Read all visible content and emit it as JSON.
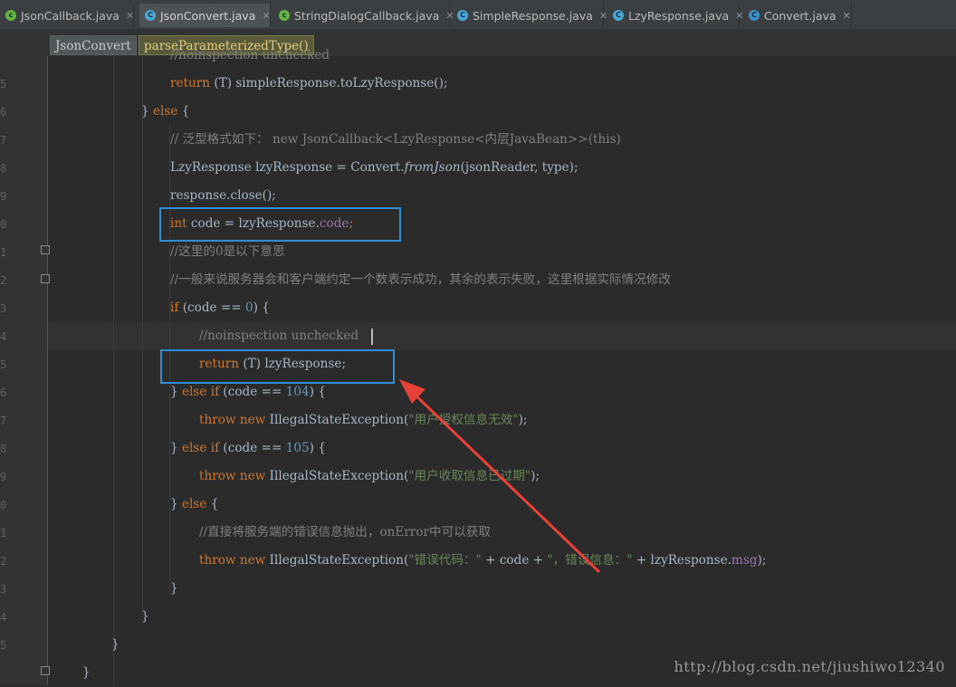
{
  "tabs": [
    {
      "label": "JsonCallback.java",
      "icon": "java-class-icon",
      "active": false
    },
    {
      "label": "JsonConvert.java",
      "icon": "java-class-icon",
      "active": true
    },
    {
      "label": "StringDialogCallback.java",
      "icon": "java-class-icon",
      "active": false
    },
    {
      "label": "SimpleResponse.java",
      "icon": "java-class-icon",
      "active": false
    },
    {
      "label": "LzyResponse.java",
      "icon": "java-class-icon",
      "active": false
    },
    {
      "label": "Convert.java",
      "icon": "java-class-icon",
      "active": false
    }
  ],
  "tab_close_glyph": "✕",
  "breadcrumbs": {
    "class_name": "JsonConvert",
    "method_name": "parseParameterizedType()"
  },
  "gutter": {
    "line_digits": [
      "5",
      "6",
      "7",
      "8",
      "9",
      "0",
      "1",
      "2",
      "3",
      "4",
      "5",
      "6",
      "7",
      "8",
      "9",
      "0",
      "1",
      "2",
      "3",
      "4",
      "5"
    ]
  },
  "code": {
    "l0": "//noinspection unchecked",
    "l1_return": "return",
    "l1_rest": " (T) simpleResponse.toLzyResponse();",
    "l2_brace": "} ",
    "l2_else": "else",
    "l2_open": " {",
    "l3": "// 泛型格式如下： new JsonCallback<LzyResponse<内层JavaBean>>(this)",
    "l4_a": "LzyResponse lzyResponse = Convert.",
    "l4_b": "fromJson",
    "l4_c": "(jsonReader, type);",
    "l5": "response.close();",
    "l6_int": "int",
    "l6_mid": " code = lzyResponse.",
    "l6_field": "code",
    "l6_end": ";",
    "l7": "//这里的0是以下意思",
    "l8": "//一般来说服务器会和客户端约定一个数表示成功，其余的表示失败，这里根据实际情况修改",
    "l9_if": "if",
    "l9_a": " (code == ",
    "l9_num": "0",
    "l9_b": ") {",
    "l10": "//noinspection unchecked",
    "l11_return": "return",
    "l11_rest": " (T) lzyResponse;",
    "l12_a": "} ",
    "l12_kw": "else if",
    "l12_b": " (code == ",
    "l12_num": "104",
    "l12_c": ") {",
    "l13_throw": "throw",
    "l13_new": " new",
    "l13_a": " IllegalStateException(",
    "l13_str": "\"用户授权信息无效\"",
    "l13_end": ");",
    "l14_a": "} ",
    "l14_kw": "else if",
    "l14_b": " (code == ",
    "l14_num": "105",
    "l14_c": ") {",
    "l15_throw": "throw",
    "l15_new": " new",
    "l15_a": " IllegalStateException(",
    "l15_str": "\"用户收取信息已过期\"",
    "l15_end": ");",
    "l16_a": "} ",
    "l16_kw": "else",
    "l16_b": " {",
    "l17": "//直接将服务端的错误信息抛出，onError中可以获取",
    "l18_throw": "throw",
    "l18_new": " new",
    "l18_a": " IllegalStateException(",
    "l18_str1": "\"错误代码：\"",
    "l18_b": " + code + ",
    "l18_str2": "\"，错误信息：\"",
    "l18_c": " + lzyResponse.",
    "l18_field": "msg",
    "l18_end": ");",
    "l19": "}",
    "l20": "}",
    "l21": "}",
    "l22": "}"
  },
  "annotations": {
    "box_color": "#2e8fd8",
    "arrow_color": "#e8413a"
  },
  "watermark": "http://blog.csdn.net/jiushiwo12340"
}
